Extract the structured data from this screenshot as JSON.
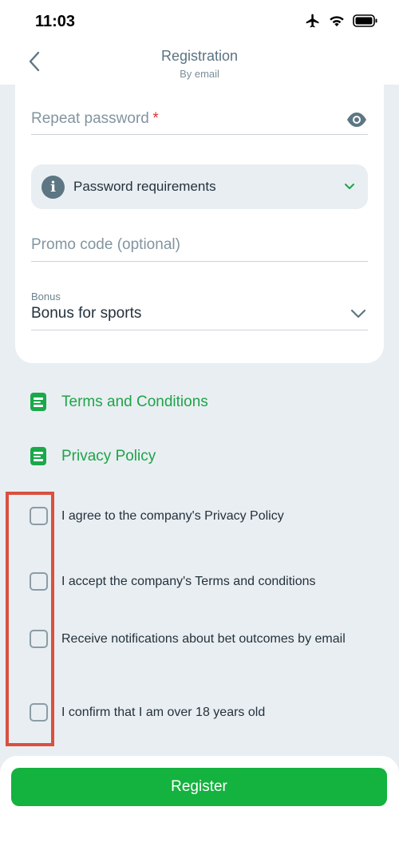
{
  "status_bar": {
    "time": "11:03",
    "icons": [
      "airplane-icon",
      "wifi-icon",
      "battery-icon"
    ]
  },
  "header": {
    "title": "Registration",
    "subtitle": "By email",
    "back_icon": "chevron-left-icon"
  },
  "form": {
    "repeat_password": {
      "placeholder": "Repeat password",
      "required_mark": "*",
      "toggle_icon": "eye-icon"
    },
    "password_requirements": {
      "label": "Password requirements",
      "icon": "info-icon",
      "icon_glyph": "i",
      "expand_icon": "chevron-down-icon"
    },
    "promo_code": {
      "placeholder": "Promo code (optional)"
    },
    "bonus": {
      "label": "Bonus",
      "value": "Bonus for sports",
      "expand_icon": "chevron-down-icon"
    }
  },
  "links": [
    {
      "label": "Terms and Conditions",
      "icon": "document-icon"
    },
    {
      "label": "Privacy Policy",
      "icon": "document-icon"
    }
  ],
  "consents": [
    {
      "label": "I agree to the company's Privacy Policy",
      "checked": false
    },
    {
      "label": "I accept the company's Terms and conditions",
      "checked": false
    },
    {
      "label": "Receive notifications about bet outcomes by email",
      "checked": false
    },
    {
      "label": "I confirm that I am over 18 years old",
      "checked": false
    }
  ],
  "register_button": {
    "label": "Register"
  },
  "colors": {
    "accent_green": "#14b23e",
    "link_green": "#1ea448",
    "background": "#e9eef2",
    "highlight_red": "#d9503f"
  }
}
